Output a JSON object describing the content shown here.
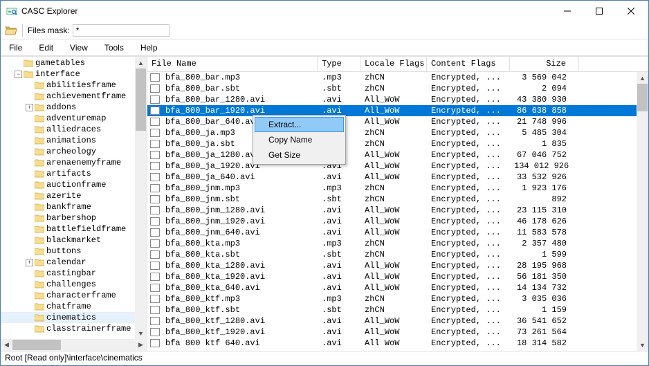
{
  "window": {
    "title": "CASC Explorer"
  },
  "toolbar": {
    "mask_label": "Files mask:",
    "mask_value": "*"
  },
  "menu": {
    "file": "File",
    "edit": "Edit",
    "view": "View",
    "tools": "Tools",
    "help": "Help"
  },
  "tree": {
    "top_cut": "gametables",
    "root": "interface",
    "items": [
      {
        "l": "abilitiesframe",
        "e": ""
      },
      {
        "l": "achievementframe",
        "e": ""
      },
      {
        "l": "addons",
        "e": "+"
      },
      {
        "l": "adventuremap",
        "e": ""
      },
      {
        "l": "alliedraces",
        "e": ""
      },
      {
        "l": "animations",
        "e": ""
      },
      {
        "l": "archeology",
        "e": ""
      },
      {
        "l": "arenaenemyframe",
        "e": ""
      },
      {
        "l": "artifacts",
        "e": ""
      },
      {
        "l": "auctionframe",
        "e": ""
      },
      {
        "l": "azerite",
        "e": ""
      },
      {
        "l": "bankframe",
        "e": ""
      },
      {
        "l": "barbershop",
        "e": ""
      },
      {
        "l": "battlefieldframe",
        "e": ""
      },
      {
        "l": "blackmarket",
        "e": ""
      },
      {
        "l": "buttons",
        "e": ""
      },
      {
        "l": "calendar",
        "e": "+"
      },
      {
        "l": "castingbar",
        "e": ""
      },
      {
        "l": "challenges",
        "e": ""
      },
      {
        "l": "characterframe",
        "e": ""
      },
      {
        "l": "chatframe",
        "e": ""
      },
      {
        "l": "cinematics",
        "e": "",
        "sel": true
      },
      {
        "l": "classtrainerframe",
        "e": ""
      }
    ]
  },
  "columns": {
    "name": "File Name",
    "type": "Type",
    "locale": "Locale Flags",
    "content": "Content Flags",
    "size": "Size"
  },
  "files": [
    {
      "n": "bfa_800_bar.mp3",
      "t": ".mp3",
      "lf": "zhCN",
      "cf": "Encrypted, ...",
      "s": "3 569 042"
    },
    {
      "n": "bfa_800_bar.sbt",
      "t": ".sbt",
      "lf": "zhCN",
      "cf": "Encrypted, ...",
      "s": "2 094"
    },
    {
      "n": "bfa_800_bar_1280.avi",
      "t": ".avi",
      "lf": "All_WoW",
      "cf": "Encrypted, ...",
      "s": "43 380 930"
    },
    {
      "n": "bfa_800_bar_1920.avi",
      "t": ".avi",
      "lf": "All_WoW",
      "cf": "Encrypted, ...",
      "s": "86 638 858",
      "sel": true
    },
    {
      "n": "bfa_800_bar_640.avi",
      "t": ".avi",
      "lf": "All_WoW",
      "cf": "Encrypted, ...",
      "s": "21 748 996"
    },
    {
      "n": "bfa_800_ja.mp3",
      "t": ".mp3",
      "lf": "zhCN",
      "cf": "Encrypted, ...",
      "s": "5 485 304"
    },
    {
      "n": "bfa_800_ja.sbt",
      "t": ".sbt",
      "lf": "zhCN",
      "cf": "Encrypted, ...",
      "s": "1 835"
    },
    {
      "n": "bfa_800_ja_1280.avi",
      "t": ".avi",
      "lf": "All_WoW",
      "cf": "Encrypted, ...",
      "s": "67 046 752"
    },
    {
      "n": "bfa_800_ja_1920.avi",
      "t": ".avi",
      "lf": "All_WoW",
      "cf": "Encrypted, ...",
      "s": "134 012 926"
    },
    {
      "n": "bfa_800_ja_640.avi",
      "t": ".avi",
      "lf": "All_WoW",
      "cf": "Encrypted, ...",
      "s": "33 532 926"
    },
    {
      "n": "bfa_800_jnm.mp3",
      "t": ".mp3",
      "lf": "zhCN",
      "cf": "Encrypted, ...",
      "s": "1 923 176"
    },
    {
      "n": "bfa_800_jnm.sbt",
      "t": ".sbt",
      "lf": "zhCN",
      "cf": "Encrypted, ...",
      "s": "892"
    },
    {
      "n": "bfa_800_jnm_1280.avi",
      "t": ".avi",
      "lf": "All_WoW",
      "cf": "Encrypted, ...",
      "s": "23 115 310"
    },
    {
      "n": "bfa_800_jnm_1920.avi",
      "t": ".avi",
      "lf": "All_WoW",
      "cf": "Encrypted, ...",
      "s": "46 178 626"
    },
    {
      "n": "bfa_800_jnm_640.avi",
      "t": ".avi",
      "lf": "All_WoW",
      "cf": "Encrypted, ...",
      "s": "11 583 578"
    },
    {
      "n": "bfa_800_kta.mp3",
      "t": ".mp3",
      "lf": "zhCN",
      "cf": "Encrypted, ...",
      "s": "2 357 480"
    },
    {
      "n": "bfa_800_kta.sbt",
      "t": ".sbt",
      "lf": "zhCN",
      "cf": "Encrypted, ...",
      "s": "1 599"
    },
    {
      "n": "bfa_800_kta_1280.avi",
      "t": ".avi",
      "lf": "All_WoW",
      "cf": "Encrypted, ...",
      "s": "28 195 968"
    },
    {
      "n": "bfa_800_kta_1920.avi",
      "t": ".avi",
      "lf": "All_WoW",
      "cf": "Encrypted, ...",
      "s": "56 181 350"
    },
    {
      "n": "bfa_800_kta_640.avi",
      "t": ".avi",
      "lf": "All_WoW",
      "cf": "Encrypted, ...",
      "s": "14 134 732"
    },
    {
      "n": "bfa_800_ktf.mp3",
      "t": ".mp3",
      "lf": "zhCN",
      "cf": "Encrypted, ...",
      "s": "3 035 036"
    },
    {
      "n": "bfa_800_ktf.sbt",
      "t": ".sbt",
      "lf": "zhCN",
      "cf": "Encrypted, ...",
      "s": "1 159"
    },
    {
      "n": "bfa_800_ktf_1280.avi",
      "t": ".avi",
      "lf": "All_WoW",
      "cf": "Encrypted, ...",
      "s": "36 541 652"
    },
    {
      "n": "bfa_800_ktf_1920.avi",
      "t": ".avi",
      "lf": "All_WoW",
      "cf": "Encrypted, ...",
      "s": "73 261 564"
    },
    {
      "n": "bfa 800 ktf 640.avi",
      "t": ".avi",
      "lf": "All WoW",
      "cf": "Encrypted, ...",
      "s": "18 314 582"
    }
  ],
  "context": {
    "extract": "Extract...",
    "copy": "Copy Name",
    "getsize": "Get Size"
  },
  "status": "Root [Read only]\\interface\\cinematics"
}
